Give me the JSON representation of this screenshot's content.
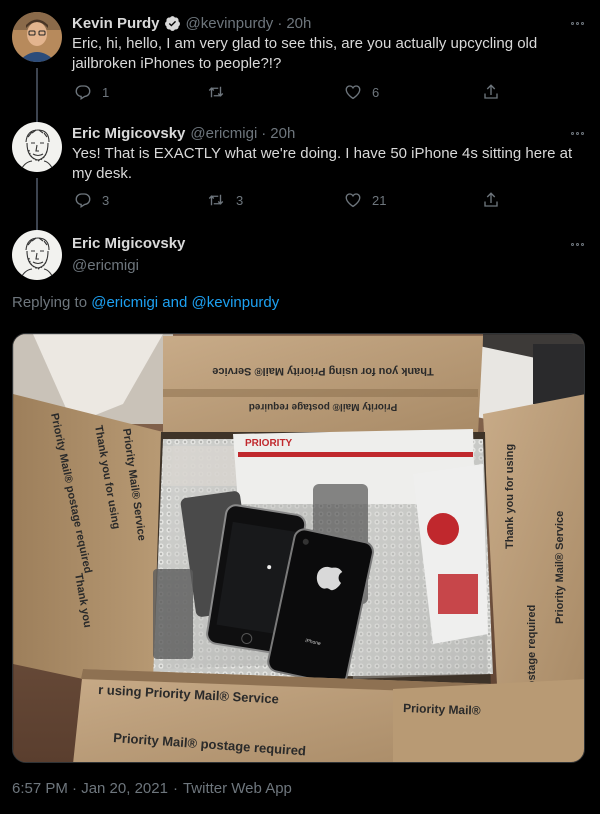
{
  "tweet1": {
    "name": "Kevin Purdy",
    "handle": "@kevinpurdy",
    "time": "20h",
    "text": "Eric, hi, hello, I am very glad to see this, are you actually upcycling old jailbroken iPhones to people?!?",
    "reply_count": "1",
    "retweet_count": "",
    "like_count": "6"
  },
  "tweet2": {
    "name": "Eric Migicovsky",
    "handle": "@ericmigi",
    "time": "20h",
    "text": "Yes! That is EXACTLY what we're doing. I have 50 iPhone 4s sitting here at my desk.",
    "reply_count": "3",
    "retweet_count": "3",
    "like_count": "21"
  },
  "main": {
    "name": "Eric Migicovsky",
    "handle": "@ericmigi",
    "replying_prefix": "Replying to",
    "replying_user1": "@ericmigi",
    "replying_and": "and",
    "replying_user2": "@kevinpurdy",
    "timestamp": "6:57 PM · Jan 20, 2021",
    "source": "Twitter Web App"
  },
  "photo": {
    "box_text_1": "Thank you for using Priority Mail® Service",
    "box_text_2": "Priority Mail® postage required",
    "box_text_3": "Thank you for using",
    "box_text_4": "Priority Mail® Service",
    "box_text_5": "Priority Mail® postage required",
    "box_text_6": "r using Priority Mail® Service",
    "box_text_7": "Priority Mail®",
    "box_text_8": "Priority Mail® postage required",
    "box_text_9": "Thank you for using",
    "box_text_10": "Priority Mail® Service",
    "box_text_11": "postage required",
    "box_text_12": "Priority Mail® Service",
    "box_text_13": "Priority Mail® postage required",
    "box_text_14": "Thank you",
    "envelope_text": "PRIORITY",
    "phone_label": "iPhone"
  },
  "colors": {
    "accent": "#1da1f2",
    "muted": "#6e767d",
    "text": "#d9d9d9",
    "background": "#000000"
  }
}
